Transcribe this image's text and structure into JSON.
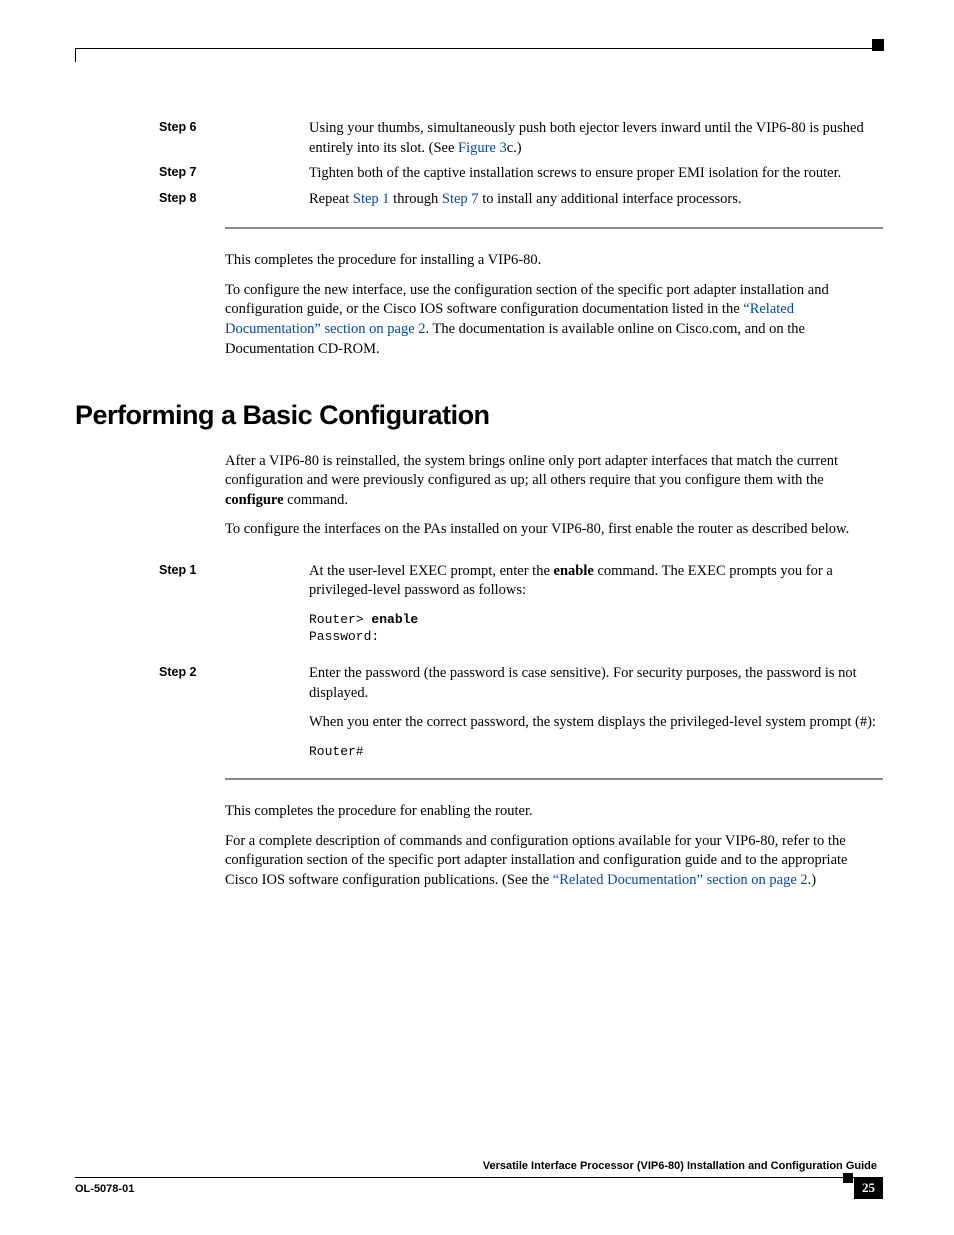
{
  "steps_a": [
    {
      "label": "Step 6",
      "segments": [
        {
          "t": "Using your thumbs, simultaneously push both ejector levers inward until the VIP6-80 is pushed entirely into its slot. (See "
        },
        {
          "t": "Figure 3",
          "link": true
        },
        {
          "t": "c.)"
        }
      ]
    },
    {
      "label": "Step 7",
      "segments": [
        {
          "t": "Tighten both of the captive installation screws to ensure proper EMI isolation for the router."
        }
      ]
    },
    {
      "label": "Step 8",
      "segments": [
        {
          "t": "Repeat "
        },
        {
          "t": "Step 1",
          "link": true
        },
        {
          "t": " through "
        },
        {
          "t": "Step 7",
          "link": true
        },
        {
          "t": " to install any additional interface processors."
        }
      ]
    }
  ],
  "after_steps_a": [
    {
      "segments": [
        {
          "t": "This completes the procedure for installing a VIP6-80."
        }
      ]
    },
    {
      "segments": [
        {
          "t": "To configure the new interface, use the configuration section of the specific port adapter installation and configuration guide, or the Cisco IOS software configuration documentation listed in the "
        },
        {
          "t": "“Related Documentation” section on page 2",
          "link": true
        },
        {
          "t": ". The documentation is available online on Cisco.com, and on the Documentation CD-ROM."
        }
      ]
    }
  ],
  "heading": "Performing a Basic Configuration",
  "intro": [
    {
      "segments": [
        {
          "t": "After a VIP6-80 is reinstalled, the system brings online only port adapter interfaces that match the current configuration and were previously configured as up; all others require that you configure them with the "
        },
        {
          "t": "configure",
          "bold": true
        },
        {
          "t": " command."
        }
      ]
    },
    {
      "segments": [
        {
          "t": "To configure the interfaces on the PAs installed on your VIP6-80, first enable the router as described below."
        }
      ]
    }
  ],
  "steps_b": [
    {
      "label": "Step 1",
      "body": [
        {
          "type": "p",
          "segments": [
            {
              "t": "At the user-level EXEC prompt, enter the "
            },
            {
              "t": "enable",
              "bold": true
            },
            {
              "t": " command. The EXEC prompts you for a privileged-level password as follows:"
            }
          ]
        },
        {
          "type": "mono",
          "lines": [
            [
              {
                "t": "Router> "
              },
              {
                "t": "enable",
                "bold": true
              }
            ],
            [
              {
                "t": "Password:"
              }
            ]
          ]
        }
      ]
    },
    {
      "label": "Step 2",
      "body": [
        {
          "type": "p",
          "segments": [
            {
              "t": "Enter the password (the password is case sensitive). For security purposes, the password is not displayed."
            }
          ]
        },
        {
          "type": "p",
          "segments": [
            {
              "t": "When you enter the correct password, the system displays the privileged-level system prompt (#):"
            }
          ]
        },
        {
          "type": "mono",
          "lines": [
            [
              {
                "t": "Router#"
              }
            ]
          ]
        }
      ]
    }
  ],
  "after_steps_b": [
    {
      "segments": [
        {
          "t": "This completes the procedure for enabling the router."
        }
      ]
    },
    {
      "segments": [
        {
          "t": "For a complete description of commands and configuration options available for your VIP6-80, refer to the configuration section of the specific port adapter installation and configuration guide and to the appropriate Cisco IOS software configuration publications. (See the "
        },
        {
          "t": "“Related Documentation” section on page 2",
          "link": true
        },
        {
          "t": ".)"
        }
      ]
    }
  ],
  "footer": {
    "title": "Versatile Interface Processor (VIP6-80) Installation and Configuration Guide",
    "docnum": "OL-5078-01",
    "page": "25"
  }
}
